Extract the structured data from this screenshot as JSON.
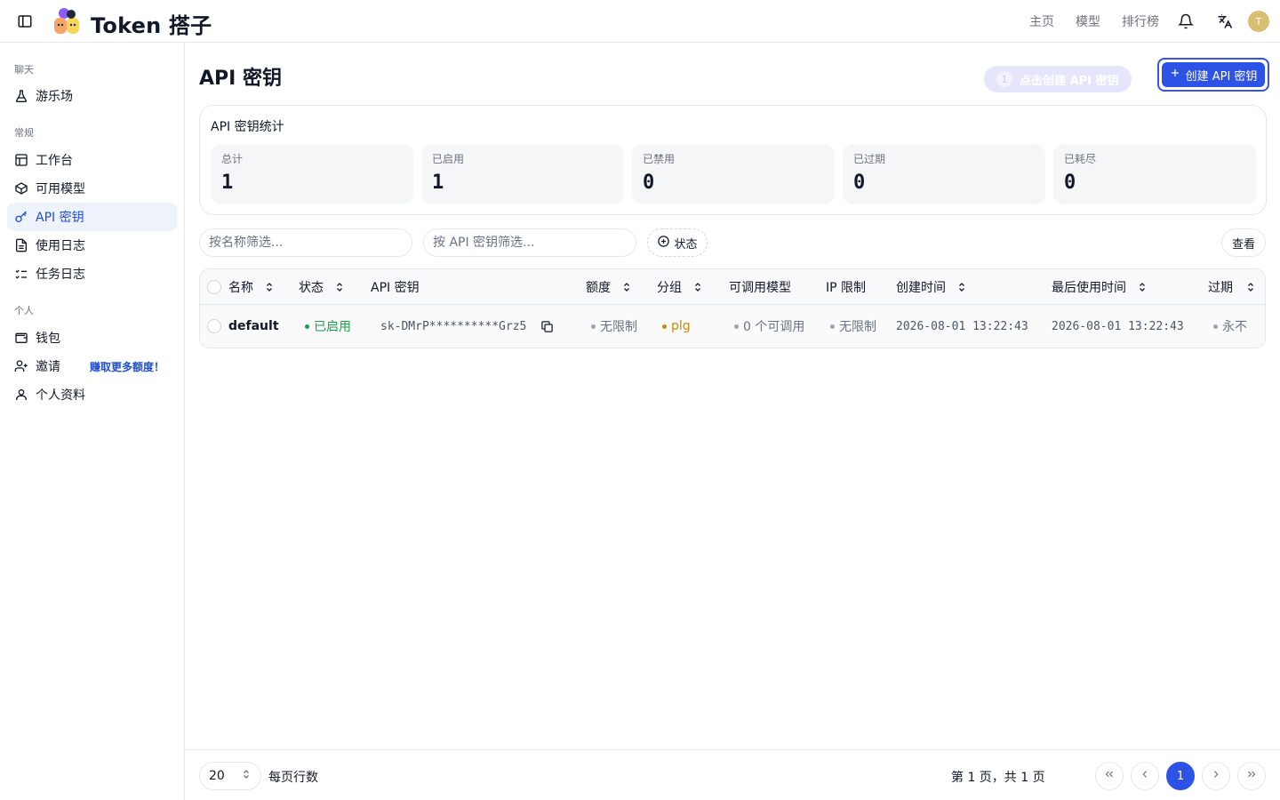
{
  "header": {
    "brand": "Token 搭子",
    "nav": [
      "主页",
      "模型",
      "排行榜"
    ],
    "avatar_initial": "T"
  },
  "sidebar": {
    "sections": {
      "chat": "聊天",
      "general": "常规",
      "personal": "个人"
    },
    "items": {
      "playground": "游乐场",
      "dashboard": "工作台",
      "models": "可用模型",
      "api_keys": "API 密钥",
      "usage_logs": "使用日志",
      "task_logs": "任务日志",
      "wallet": "钱包",
      "invite": "邀请",
      "profile": "个人资料"
    },
    "invite_promo": "赚取更多额度！"
  },
  "main": {
    "title": "API 密钥",
    "hint": {
      "step": "1",
      "text": "点击创建 API 密钥"
    },
    "create_button": "创建 API 密钥",
    "stats": {
      "title": "API 密钥统计",
      "items": [
        {
          "label": "总计",
          "value": "1"
        },
        {
          "label": "已启用",
          "value": "1"
        },
        {
          "label": "已禁用",
          "value": "0"
        },
        {
          "label": "已过期",
          "value": "0"
        },
        {
          "label": "已耗尽",
          "value": "0"
        }
      ]
    },
    "filters": {
      "name_placeholder": "按名称筛选...",
      "key_placeholder": "按 API 密钥筛选...",
      "status": "状态",
      "view": "查看"
    },
    "table": {
      "columns": {
        "name": "名称",
        "status": "状态",
        "key": "API 密钥",
        "quota": "额度",
        "group": "分组",
        "models": "可调用模型",
        "ip": "IP 限制",
        "created": "创建时间",
        "last_used": "最后使用时间",
        "expires": "过期"
      },
      "rows": [
        {
          "name": "default",
          "status": "已启用",
          "key": "sk-DMrP**********Grz5",
          "quota": "无限制",
          "group": "plg",
          "models": "0 个可调用",
          "ip": "无限制",
          "created": "2026-08-01 13:22:43",
          "last_used": "2026-08-01 13:22:43",
          "expires": "永不"
        }
      ]
    }
  },
  "footer": {
    "page_size": "20",
    "rows_label": "每页行数",
    "page_info": "第 1 页，共 1 页",
    "current_page": "1"
  },
  "colors": {
    "accent": "#2d52e6",
    "status_enabled": "#16a34a",
    "group": "#ca8a04",
    "muted_dot": "#9ca3af"
  }
}
